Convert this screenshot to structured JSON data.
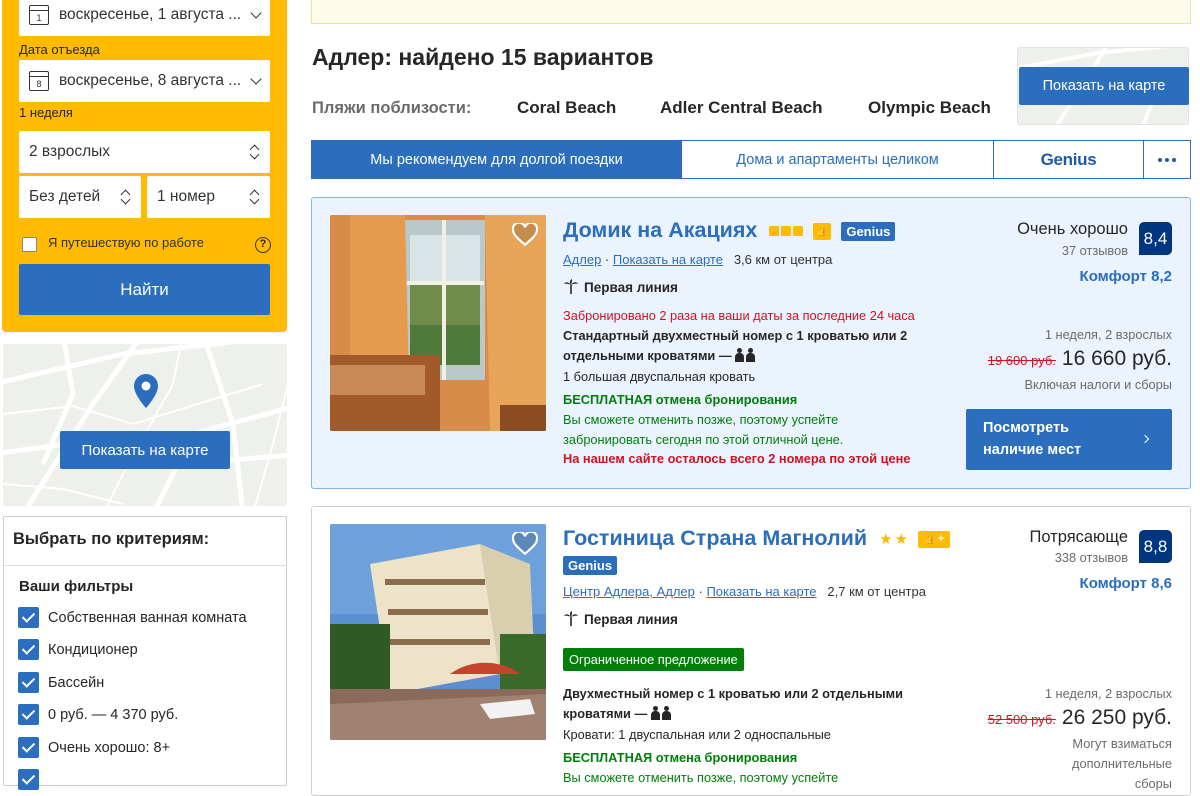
{
  "search": {
    "checkin_value": "воскресенье, 1 августа ...",
    "checkin_day": "1",
    "checkout_label": "Дата отъезда",
    "checkout_value": "воскресенье, 8 августа ...",
    "checkout_day": "8",
    "duration_text": "1 неделя",
    "adults": "2 взрослых",
    "children": "Без детей",
    "rooms": "1 номер",
    "work_trip_label": "Я путешествую по работе",
    "help": "?",
    "find_button": "Найти"
  },
  "map": {
    "button": "Показать на карте"
  },
  "filters": {
    "title": "Выбрать по критериям:",
    "subtitle": "Ваши фильтры",
    "items": [
      {
        "label": "Собственная ванная комната",
        "checked": true
      },
      {
        "label": "Кондиционер",
        "checked": true
      },
      {
        "label": "Бассейн",
        "checked": true
      },
      {
        "label": "0 руб. — 4 370 руб.",
        "checked": true
      },
      {
        "label": "Очень хорошо: 8+",
        "checked": true
      }
    ]
  },
  "results": {
    "title": "Адлер: найдено 15 вариантов",
    "beaches_label": "Пляжи поблизости:",
    "beaches": [
      "Coral Beach",
      "Adler Central Beach",
      "Olympic Beach"
    ],
    "map_button": "Показать на карте"
  },
  "tabs": [
    {
      "label": "Мы рекомендуем для долгой поездки",
      "active": true
    },
    {
      "label": "Дома и апартаменты целиком",
      "active": false
    },
    {
      "label": "Genius",
      "active": false
    }
  ],
  "properties": [
    {
      "name": "Домик на Акациях",
      "stars": 3,
      "genius": "Genius",
      "location_link": "Адлер",
      "map_link": "Показать на карте",
      "distance": "3,6 км от центра",
      "feature": "Первая линия",
      "booked_note": "Забронировано 2 раза на ваши даты за последние 24 часа",
      "room": "Стандартный двухместный номер с 1 кроватью или 2 отдельными кроватями",
      "bed": "1 большая двуспальная кровать",
      "cancel_title": "БЕСПЛАТНАЯ отмена бронирования",
      "cancel_text": "Вы сможете отменить позже, поэтому успейте забронировать сегодня по этой отличной цене.",
      "scarcity": "На нашем сайте осталось всего 2 номера по этой цене",
      "rating_word": "Очень хорошо",
      "reviews": "37 отзывов",
      "score": "8,4",
      "comfort": "Комфорт 8,2",
      "nights": "1 неделя, 2 взрослых",
      "old_price": "19 600 руб.",
      "price": "16 660 руб.",
      "taxes": "Включая налоги и сборы",
      "button": "Посмотреть наличие мест"
    },
    {
      "name": "Гостиница Страна Магнолий",
      "stars": 2,
      "genius": "Genius",
      "location_link": "Центр Адлера, Адлер",
      "map_link": "Показать на карте",
      "distance": "2,7 км от центра",
      "feature": "Первая линия",
      "badge": "Ограниченное предложение",
      "room": "Двухместный номер с 1 кроватью или 2 отдельными кроватями",
      "bed": "Кровати: 1 двуспальная или 2 односпальные",
      "cancel_title": "БЕСПЛАТНАЯ отмена бронирования",
      "cancel_text": "Вы сможете отменить позже, поэтому успейте",
      "rating_word": "Потрясающе",
      "reviews": "338 отзывов",
      "score": "8,8",
      "comfort": "Комфорт 8,6",
      "nights": "1 неделя, 2 взрослых",
      "old_price": "52 500 руб.",
      "price": "26 250 руб.",
      "taxes": "Могут взиматься дополнительные сборы"
    }
  ],
  "colors": {
    "accent": "#2a6ebd",
    "search_yellow": "#febb02",
    "score_navy": "#003580",
    "green": "#008009",
    "red": "#d4111e",
    "highlight_bg": "#ebf3ff"
  }
}
